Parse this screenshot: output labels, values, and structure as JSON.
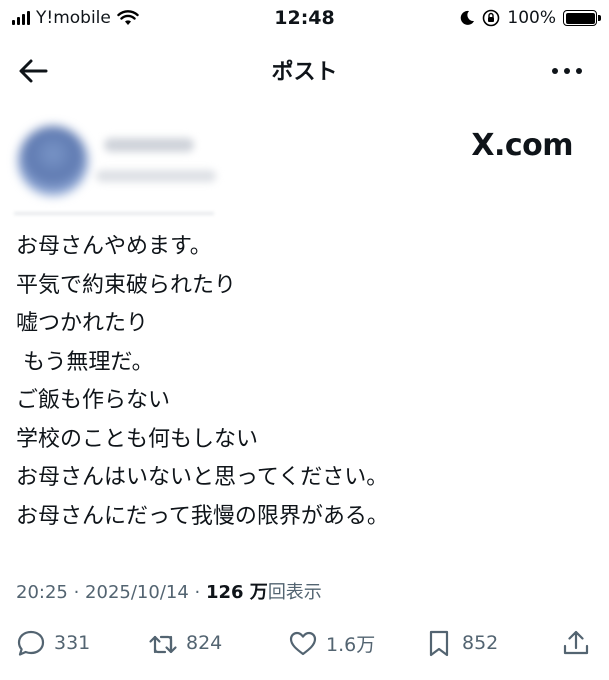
{
  "status_bar": {
    "carrier": "Y!mobile",
    "time": "12:48",
    "battery": "100%"
  },
  "nav": {
    "title": "ポスト",
    "back_icon": "arrow-left-icon",
    "more_icon": "more-horizontal-icon"
  },
  "watermark": "X.com",
  "post": {
    "lines": [
      "お母さんやめます。",
      "平気で約束破られたり",
      "嘘つかれたり",
      " もう無理だ。",
      "ご飯も作らない",
      "学校のことも何もしない",
      "お母さんはいないと思ってください。",
      "お母さんにだって我慢の限界がある。"
    ]
  },
  "meta": {
    "time": "20:25",
    "separator": " · ",
    "date": "2025/10/14",
    "views_count": "126 万",
    "views_label": "回表示"
  },
  "actions": {
    "replies": "331",
    "reposts": "824",
    "likes": "1.6万",
    "bookmarks": "852"
  },
  "colors": {
    "text": "#0f1419",
    "secondary": "#536471"
  }
}
